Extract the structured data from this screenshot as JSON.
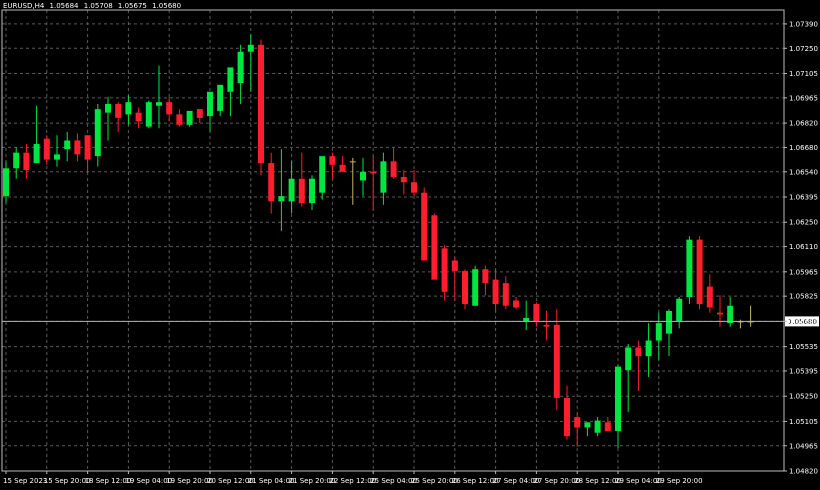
{
  "header": {
    "symbol": "EURUSD,H4",
    "open": "1.05684",
    "high": "1.05708",
    "low": "1.05675",
    "close": "1.05680"
  },
  "colors": {
    "background": "#000000",
    "grid": "#5a5a5a",
    "bull": "#00e640",
    "bear": "#ff1e2d",
    "doji": "#c8b464",
    "axis_text": "#ffffff",
    "price_line": "#b4b4b4"
  },
  "chart_data": {
    "type": "candlestick",
    "ylim": [
      1.0482,
      1.0747
    ],
    "grid": true,
    "y_ticks": [
      "1.07390",
      "1.07250",
      "1.07105",
      "1.06965",
      "1.06820",
      "1.06680",
      "1.06540",
      "1.06395",
      "1.06250",
      "1.06110",
      "1.05965",
      "1.05825",
      "1.05680",
      "1.05535",
      "1.05395",
      "1.05250",
      "1.05105",
      "1.04965",
      "1.04820"
    ],
    "x_labels": [
      {
        "index": 0,
        "label": "15 Sep 2023"
      },
      {
        "index": 4,
        "label": "15 Sep 20:00"
      },
      {
        "index": 8,
        "label": "18 Sep 12:00"
      },
      {
        "index": 12,
        "label": "19 Sep 04:00"
      },
      {
        "index": 16,
        "label": "19 Sep 20:00"
      },
      {
        "index": 20,
        "label": "20 Sep 12:00"
      },
      {
        "index": 24,
        "label": "21 Sep 04:00"
      },
      {
        "index": 28,
        "label": "21 Sep 20:00"
      },
      {
        "index": 32,
        "label": "22 Sep 12:00"
      },
      {
        "index": 36,
        "label": "25 Sep 04:00"
      },
      {
        "index": 40,
        "label": "25 Sep 20:00"
      },
      {
        "index": 44,
        "label": "26 Sep 12:00"
      },
      {
        "index": 48,
        "label": "27 Sep 04:00"
      },
      {
        "index": 52,
        "label": "27 Sep 20:00"
      },
      {
        "index": 56,
        "label": "28 Sep 12:00"
      },
      {
        "index": 60,
        "label": "29 Sep 04:00"
      },
      {
        "index": 64,
        "label": "29 Sep 20:00"
      }
    ],
    "current_price": "1.05680",
    "current_value": 1.0568,
    "candles": [
      {
        "o": 1.064,
        "h": 1.066,
        "l": 1.0636,
        "c": 1.0656
      },
      {
        "o": 1.0656,
        "h": 1.0668,
        "l": 1.065,
        "c": 1.0665
      },
      {
        "o": 1.0665,
        "h": 1.067,
        "l": 1.065,
        "c": 1.0655
      },
      {
        "o": 1.0659,
        "h": 1.0692,
        "l": 1.0659,
        "c": 1.067
      },
      {
        "o": 1.0673,
        "h": 1.0675,
        "l": 1.0658,
        "c": 1.0661
      },
      {
        "o": 1.0661,
        "h": 1.0675,
        "l": 1.0657,
        "c": 1.0664
      },
      {
        "o": 1.0667,
        "h": 1.0677,
        "l": 1.066,
        "c": 1.0672
      },
      {
        "o": 1.0672,
        "h": 1.0676,
        "l": 1.066,
        "c": 1.0664
      },
      {
        "o": 1.0675,
        "h": 1.0675,
        "l": 1.0653,
        "c": 1.0661
      },
      {
        "o": 1.0663,
        "h": 1.0693,
        "l": 1.0657,
        "c": 1.069
      },
      {
        "o": 1.0688,
        "h": 1.0697,
        "l": 1.0672,
        "c": 1.0693
      },
      {
        "o": 1.0693,
        "h": 1.0694,
        "l": 1.0677,
        "c": 1.0685
      },
      {
        "o": 1.0687,
        "h": 1.0698,
        "l": 1.0681,
        "c": 1.0694
      },
      {
        "o": 1.0688,
        "h": 1.0691,
        "l": 1.0679,
        "c": 1.0683
      },
      {
        "o": 1.068,
        "h": 1.0695,
        "l": 1.0679,
        "c": 1.0694
      },
      {
        "o": 1.0692,
        "h": 1.0715,
        "l": 1.0679,
        "c": 1.0694
      },
      {
        "o": 1.0694,
        "h": 1.0697,
        "l": 1.0683,
        "c": 1.0687
      },
      {
        "o": 1.0687,
        "h": 1.069,
        "l": 1.068,
        "c": 1.0681
      },
      {
        "o": 1.0681,
        "h": 1.0688,
        "l": 1.068,
        "c": 1.0689
      },
      {
        "o": 1.069,
        "h": 1.069,
        "l": 1.0682,
        "c": 1.0685
      },
      {
        "o": 1.0686,
        "h": 1.069,
        "l": 1.0677,
        "c": 1.07
      },
      {
        "o": 1.0689,
        "h": 1.0702,
        "l": 1.0686,
        "c": 1.0704
      },
      {
        "o": 1.07,
        "h": 1.0712,
        "l": 1.0686,
        "c": 1.0714
      },
      {
        "o": 1.0705,
        "h": 1.0727,
        "l": 1.0693,
        "c": 1.0723
      },
      {
        "o": 1.0723,
        "h": 1.0733,
        "l": 1.07,
        "c": 1.0727
      },
      {
        "o": 1.0727,
        "h": 1.073,
        "l": 1.0652,
        "c": 1.0659
      },
      {
        "o": 1.0659,
        "h": 1.0665,
        "l": 1.063,
        "c": 1.0637
      },
      {
        "o": 1.0637,
        "h": 1.0667,
        "l": 1.062,
        "c": 1.064
      },
      {
        "o": 1.0637,
        "h": 1.066,
        "l": 1.063,
        "c": 1.065
      },
      {
        "o": 1.065,
        "h": 1.0665,
        "l": 1.0634,
        "c": 1.0636
      },
      {
        "o": 1.0636,
        "h": 1.0652,
        "l": 1.0632,
        "c": 1.065
      },
      {
        "o": 1.0642,
        "h": 1.0655,
        "l": 1.0638,
        "c": 1.0663
      },
      {
        "o": 1.0663,
        "h": 1.0665,
        "l": 1.065,
        "c": 1.0658
      },
      {
        "o": 1.0658,
        "h": 1.0663,
        "l": 1.0654,
        "c": 1.0654
      },
      {
        "o": 1.066,
        "h": 1.0662,
        "l": 1.0635,
        "c": 1.066
      },
      {
        "o": 1.0649,
        "h": 1.0662,
        "l": 1.064,
        "c": 1.0654
      },
      {
        "o": 1.0654,
        "h": 1.0663,
        "l": 1.0632,
        "c": 1.0653
      },
      {
        "o": 1.0642,
        "h": 1.0665,
        "l": 1.0635,
        "c": 1.066
      },
      {
        "o": 1.066,
        "h": 1.0668,
        "l": 1.065,
        "c": 1.0651
      },
      {
        "o": 1.0651,
        "h": 1.0655,
        "l": 1.0641,
        "c": 1.0648
      },
      {
        "o": 1.0648,
        "h": 1.0655,
        "l": 1.064,
        "c": 1.0642
      },
      {
        "o": 1.0642,
        "h": 1.0645,
        "l": 1.0605,
        "c": 1.0603
      },
      {
        "o": 1.0629,
        "h": 1.063,
        "l": 1.0605,
        "c": 1.0592
      },
      {
        "o": 1.061,
        "h": 1.0612,
        "l": 1.058,
        "c": 1.0585
      },
      {
        "o": 1.0603,
        "h": 1.0605,
        "l": 1.058,
        "c": 1.0597
      },
      {
        "o": 1.0597,
        "h": 1.0598,
        "l": 1.0575,
        "c": 1.0578
      },
      {
        "o": 1.0577,
        "h": 1.06,
        "l": 1.0577,
        "c": 1.0598
      },
      {
        "o": 1.0598,
        "h": 1.06,
        "l": 1.0583,
        "c": 1.059
      },
      {
        "o": 1.0592,
        "h": 1.0598,
        "l": 1.0574,
        "c": 1.0578
      },
      {
        "o": 1.059,
        "h": 1.0594,
        "l": 1.0575,
        "c": 1.0577
      },
      {
        "o": 1.058,
        "h": 1.0582,
        "l": 1.0575,
        "c": 1.0576
      },
      {
        "o": 1.0568,
        "h": 1.058,
        "l": 1.0563,
        "c": 1.057
      },
      {
        "o": 1.0578,
        "h": 1.0579,
        "l": 1.0565,
        "c": 1.0568
      },
      {
        "o": 1.0566,
        "h": 1.0574,
        "l": 1.0557,
        "c": 1.0565
      },
      {
        "o": 1.0566,
        "h": 1.0575,
        "l": 1.0517,
        "c": 1.0524
      },
      {
        "o": 1.0524,
        "h": 1.0531,
        "l": 1.05,
        "c": 1.0502
      },
      {
        "o": 1.0513,
        "h": 1.0515,
        "l": 1.0496,
        "c": 1.0507
      },
      {
        "o": 1.0507,
        "h": 1.051,
        "l": 1.0502,
        "c": 1.051
      },
      {
        "o": 1.0504,
        "h": 1.0513,
        "l": 1.0502,
        "c": 1.0511
      },
      {
        "o": 1.051,
        "h": 1.0513,
        "l": 1.0506,
        "c": 1.0505
      },
      {
        "o": 1.0505,
        "h": 1.0543,
        "l": 1.0495,
        "c": 1.0542
      },
      {
        "o": 1.054,
        "h": 1.0555,
        "l": 1.0516,
        "c": 1.0553
      },
      {
        "o": 1.0553,
        "h": 1.0557,
        "l": 1.0528,
        "c": 1.0548
      },
      {
        "o": 1.0548,
        "h": 1.0567,
        "l": 1.0536,
        "c": 1.0557
      },
      {
        "o": 1.0557,
        "h": 1.0573,
        "l": 1.0546,
        "c": 1.0567
      },
      {
        "o": 1.0561,
        "h": 1.0575,
        "l": 1.0548,
        "c": 1.0574
      },
      {
        "o": 1.0568,
        "h": 1.0582,
        "l": 1.0564,
        "c": 1.0581
      },
      {
        "o": 1.0582,
        "h": 1.0617,
        "l": 1.0578,
        "c": 1.0615
      },
      {
        "o": 1.0615,
        "h": 1.0617,
        "l": 1.0575,
        "c": 1.0578
      },
      {
        "o": 1.0588,
        "h": 1.0595,
        "l": 1.0573,
        "c": 1.0576
      },
      {
        "o": 1.0573,
        "h": 1.0583,
        "l": 1.0565,
        "c": 1.0572
      },
      {
        "o": 1.0567,
        "h": 1.0582,
        "l": 1.0565,
        "c": 1.0577
      },
      {
        "o": 1.0568,
        "h": 1.0569,
        "l": 1.0564,
        "c": 1.0568
      },
      {
        "o": 1.0568,
        "h": 1.0577,
        "l": 1.0565,
        "c": 1.0568
      }
    ]
  }
}
